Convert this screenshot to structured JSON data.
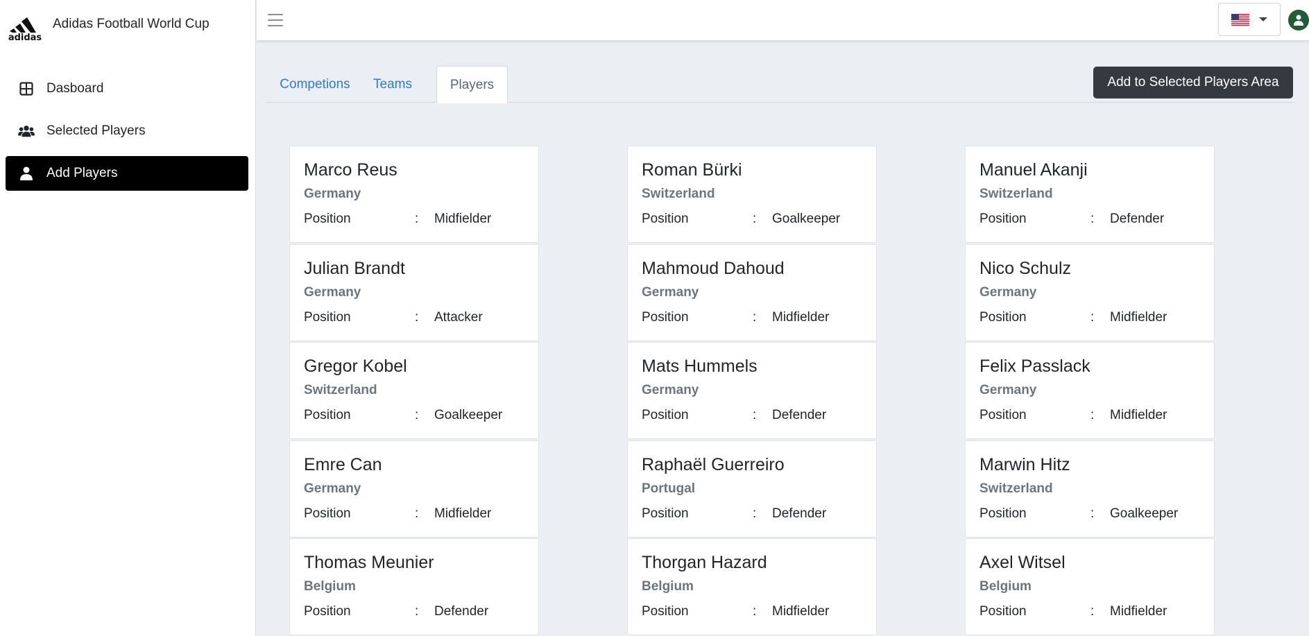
{
  "brand": {
    "title": "Adidas Football World Cup",
    "logo_text": "adidas"
  },
  "sidebar": {
    "items": [
      {
        "label": "Dasboard",
        "icon": "table-icon",
        "active": false
      },
      {
        "label": "Selected Players",
        "icon": "users-icon",
        "active": false
      },
      {
        "label": "Add Players",
        "icon": "user-icon",
        "active": true
      }
    ]
  },
  "topbar": {
    "language_icon": "us-flag-icon",
    "avatar_icon": "user-circle-icon"
  },
  "tabs": [
    {
      "label": "Competions",
      "active": false
    },
    {
      "label": "Teams",
      "active": false
    },
    {
      "label": "Players",
      "active": true
    }
  ],
  "actions": {
    "add_label": "Add to Selected Players Area"
  },
  "players": [
    {
      "name": "Marco Reus",
      "country": "Germany",
      "label": "Position",
      "sep": ":",
      "position": "Midfielder"
    },
    {
      "name": "Roman Bürki",
      "country": "Switzerland",
      "label": "Position",
      "sep": ":",
      "position": "Goalkeeper"
    },
    {
      "name": "Manuel Akanji",
      "country": "Switzerland",
      "label": "Position",
      "sep": ":",
      "position": "Defender"
    },
    {
      "name": "Julian Brandt",
      "country": "Germany",
      "label": "Position",
      "sep": ":",
      "position": "Attacker"
    },
    {
      "name": "Mahmoud Dahoud",
      "country": "Germany",
      "label": "Position",
      "sep": ":",
      "position": "Midfielder"
    },
    {
      "name": "Nico Schulz",
      "country": "Germany",
      "label": "Position",
      "sep": ":",
      "position": "Midfielder"
    },
    {
      "name": "Gregor Kobel",
      "country": "Switzerland",
      "label": "Position",
      "sep": ":",
      "position": "Goalkeeper"
    },
    {
      "name": "Mats Hummels",
      "country": "Germany",
      "label": "Position",
      "sep": ":",
      "position": "Defender"
    },
    {
      "name": "Felix Passlack",
      "country": "Germany",
      "label": "Position",
      "sep": ":",
      "position": "Midfielder"
    },
    {
      "name": "Emre Can",
      "country": "Germany",
      "label": "Position",
      "sep": ":",
      "position": "Midfielder"
    },
    {
      "name": "Raphaël Guerreiro",
      "country": "Portugal",
      "label": "Position",
      "sep": ":",
      "position": "Defender"
    },
    {
      "name": "Marwin Hitz",
      "country": "Switzerland",
      "label": "Position",
      "sep": ":",
      "position": "Goalkeeper"
    },
    {
      "name": "Thomas Meunier",
      "country": "Belgium",
      "label": "Position",
      "sep": ":",
      "position": "Defender"
    },
    {
      "name": "Thorgan Hazard",
      "country": "Belgium",
      "label": "Position",
      "sep": ":",
      "position": "Midfielder"
    },
    {
      "name": "Axel Witsel",
      "country": "Belgium",
      "label": "Position",
      "sep": ":",
      "position": "Midfielder"
    }
  ]
}
